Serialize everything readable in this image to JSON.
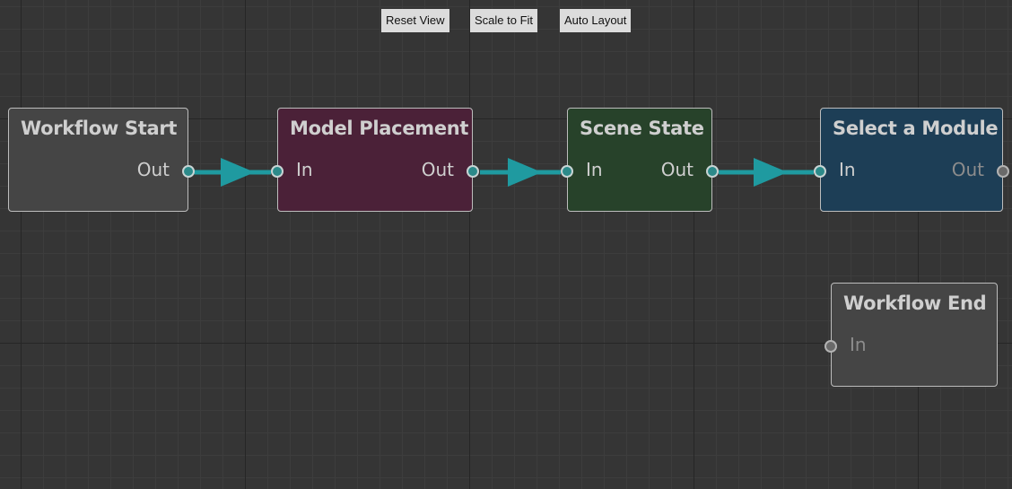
{
  "toolbar": {
    "reset_view": "Reset View",
    "scale_to_fit": "Scale to Fit",
    "auto_layout": "Auto Layout"
  },
  "nodes": {
    "workflow_start": {
      "title": "Workflow Start",
      "out": "Out",
      "color": "#454545"
    },
    "model_placement": {
      "title": "Model Placement",
      "in": "In",
      "out": "Out",
      "color": "#4b2138"
    },
    "scene_state": {
      "title": "Scene State",
      "in": "In",
      "out": "Out",
      "color": "#27422a"
    },
    "select_module": {
      "title": "Select a Module",
      "in": "In",
      "out": "Out",
      "color": "#1d3e56"
    },
    "workflow_end": {
      "title": "Workflow End",
      "in": "In",
      "color": "#454545"
    }
  },
  "colors": {
    "background": "#353535",
    "connection": "#1f9aa0",
    "port_active": "#2c8a8a",
    "port_inactive": "#6a6a6a"
  }
}
